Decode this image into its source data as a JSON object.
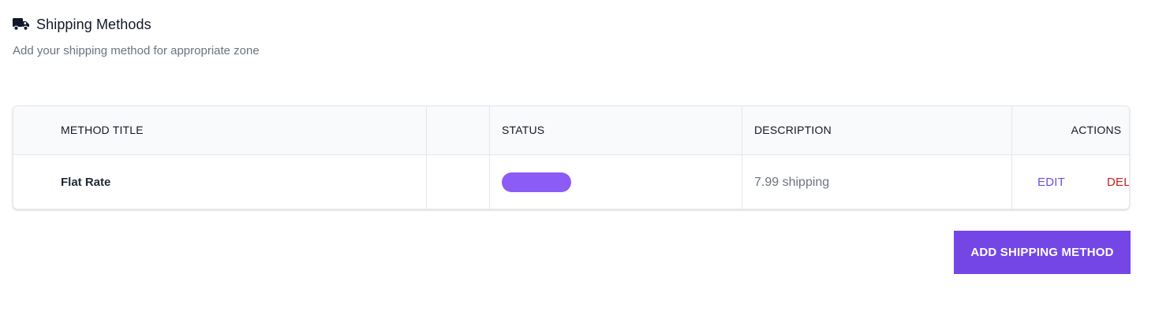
{
  "header": {
    "title": "Shipping Methods",
    "subtitle": "Add your shipping method for appropriate zone",
    "icon": "truck-icon"
  },
  "table": {
    "columns": [
      "METHOD TITLE",
      "",
      "STATUS",
      "DESCRIPTION",
      "ACTIONS"
    ],
    "rows": [
      {
        "method_title": "Flat Rate",
        "status_color": "#8b5cf6",
        "description": "7.99 shipping",
        "edit_label": "EDIT",
        "delete_label": "DELETE"
      }
    ]
  },
  "add_button_label": "ADD SHIPPING METHOD",
  "colors": {
    "accent": "#7346e5",
    "edit": "#6d4ee0",
    "delete": "#c81e1e"
  }
}
